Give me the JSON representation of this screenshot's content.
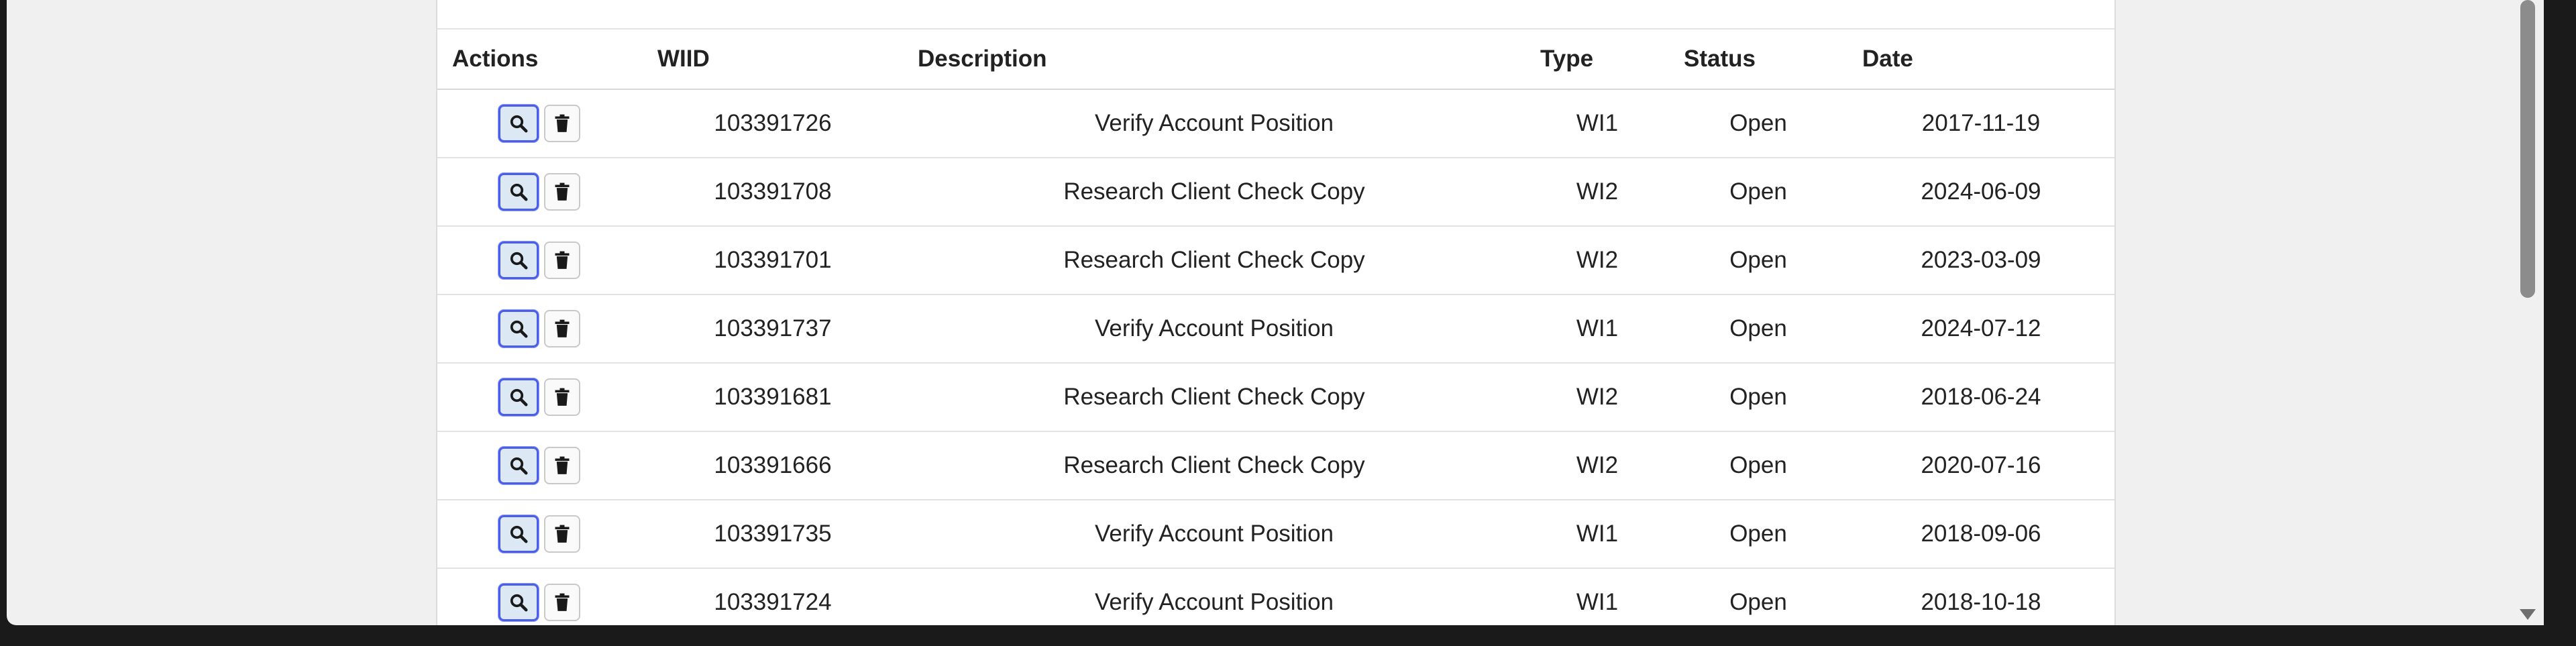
{
  "table": {
    "headers": {
      "actions": "Actions",
      "wiid": "WIID",
      "description": "Description",
      "type": "Type",
      "status": "Status",
      "date": "Date"
    },
    "rows": [
      {
        "wiid": "103391726",
        "description": "Verify Account Position",
        "type": "WI1",
        "status": "Open",
        "date": "2017-11-19"
      },
      {
        "wiid": "103391708",
        "description": "Research Client Check Copy",
        "type": "WI2",
        "status": "Open",
        "date": "2024-06-09"
      },
      {
        "wiid": "103391701",
        "description": "Research Client Check Copy",
        "type": "WI2",
        "status": "Open",
        "date": "2023-03-09"
      },
      {
        "wiid": "103391737",
        "description": "Verify Account Position",
        "type": "WI1",
        "status": "Open",
        "date": "2024-07-12"
      },
      {
        "wiid": "103391681",
        "description": "Research Client Check Copy",
        "type": "WI2",
        "status": "Open",
        "date": "2018-06-24"
      },
      {
        "wiid": "103391666",
        "description": "Research Client Check Copy",
        "type": "WI2",
        "status": "Open",
        "date": "2020-07-16"
      },
      {
        "wiid": "103391735",
        "description": "Verify Account Position",
        "type": "WI1",
        "status": "Open",
        "date": "2018-09-06"
      },
      {
        "wiid": "103391724",
        "description": "Verify Account Position",
        "type": "WI1",
        "status": "Open",
        "date": "2018-10-18"
      }
    ]
  },
  "icons": {
    "view": "search-icon",
    "delete": "trash-icon"
  },
  "colors": {
    "view_button_border": "#4a5ee8",
    "view_button_fill": "#dce9f4"
  }
}
